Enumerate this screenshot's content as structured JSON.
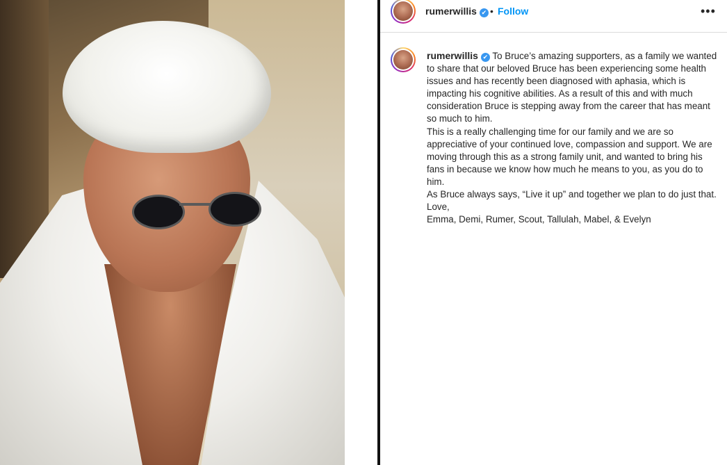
{
  "post": {
    "image_alt": "Photo of man in white towel head wrap, sunglasses and bathrobe"
  },
  "header": {
    "username": "rumerwillis",
    "verified_icon": "✔",
    "separator": "•",
    "follow_label": "Follow",
    "more_label": "•••"
  },
  "caption": {
    "username": "rumerwillis",
    "verified_icon": "✔",
    "paragraphs": [
      "To Bruce’s amazing supporters, as a family we wanted to share that our beloved Bruce has been experiencing some health issues and has recently been diagnosed with aphasia, which is impacting his cognitive abilities. As a result of this and with much consideration Bruce is stepping away from the career that has meant so much to him.",
      "This is a really challenging time for our family and we are so appreciative of your continued love, compassion and support. We are moving through this as a strong family unit, and wanted to bring his fans in because we know how much he means to you, as you do to him.",
      "As Bruce always says, “Live it up” and together we plan to do just that.",
      "Love,",
      "Emma, Demi, Rumer, Scout, Tallulah, Mabel, & Evelyn"
    ]
  },
  "colors": {
    "link_blue": "#0095f6",
    "verified_blue": "#3897f0",
    "text": "#262626",
    "border": "#dbdbdb"
  }
}
